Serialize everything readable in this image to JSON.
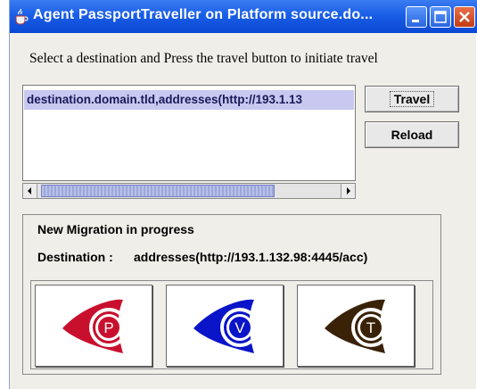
{
  "window": {
    "title": "Agent PassportTraveller on Platform source.do..."
  },
  "instruction": "Select a destination and Press the travel button to initiate travel",
  "destinations": {
    "items": [
      "destination.domain.tld,addresses(http://193.1.13"
    ],
    "selected_index": 0
  },
  "buttons": {
    "travel": "Travel",
    "reload": "Reload"
  },
  "migration": {
    "title": "New Migration in progress",
    "destination_label": "Destination :",
    "destination_value": "addresses(http://193.1.132.98:4445/acc)",
    "phases": [
      {
        "letter": "P",
        "color": "#c8102e"
      },
      {
        "letter": "V",
        "color": "#0a14c8"
      },
      {
        "letter": "T",
        "color": "#3a2208"
      }
    ]
  },
  "colors": {
    "titlebar": "#1a5ee8",
    "selection": "#c8c8f0",
    "window_bg": "#f0eee8"
  },
  "icons": [
    "java-cup-icon",
    "minimize-icon",
    "maximize-icon",
    "close-icon",
    "scroll-left-arrow-icon",
    "scroll-right-arrow-icon"
  ]
}
